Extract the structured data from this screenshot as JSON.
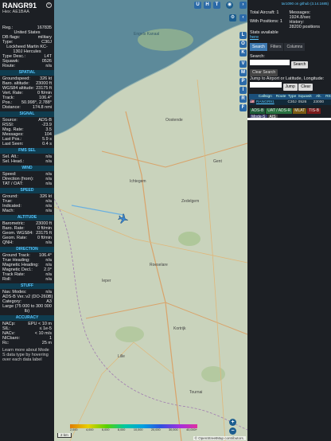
{
  "info": {
    "callsign": "RANGR91",
    "hex": "Hex: AE1BAA",
    "general": [
      {
        "k": "Reg.:",
        "v": "167835"
      },
      {
        "k": "",
        "v": "United States"
      },
      {
        "k": "DB flags:",
        "v": "military"
      },
      {
        "k": "Type:",
        "v": "C30J"
      },
      {
        "k": "",
        "v": "Lockheed Martin KC-130J Hercules"
      },
      {
        "k": "Type Desc.:",
        "v": "L4T"
      },
      {
        "k": "Squawk:",
        "v": "0526"
      },
      {
        "k": "Route:",
        "v": "n/a"
      }
    ],
    "sections": [
      {
        "title": "SPATIAL",
        "rows": [
          {
            "k": "Groundspeed:",
            "v": "326 kt"
          },
          {
            "k": "Baro. altitude:",
            "v": "23000 ft"
          },
          {
            "k": "WGS84 altitude:",
            "v": "23175 ft"
          },
          {
            "k": "Vert. Rate:",
            "v": "0 ft/min"
          },
          {
            "k": "Track:",
            "v": "106.4°"
          },
          {
            "k": "Pos.:",
            "v": "50.998°, 2.788°"
          },
          {
            "k": "Distance:",
            "v": "174.8 nmi"
          }
        ]
      },
      {
        "title": "SIGNAL",
        "rows": [
          {
            "k": "Source:",
            "v": "ADS-B"
          },
          {
            "k": "RSSI:",
            "v": "-23.9"
          },
          {
            "k": "Msg. Rate:",
            "v": "3.5"
          },
          {
            "k": "Messages:",
            "v": "104"
          },
          {
            "k": "Last Pos.:",
            "v": "5.9 s"
          },
          {
            "k": "Last Seen:",
            "v": "0.4 s"
          }
        ]
      },
      {
        "title": "FMS SEL",
        "rows": [
          {
            "k": "Sel. Alt.:",
            "v": "n/a"
          },
          {
            "k": "Sel. Head.:",
            "v": "n/a"
          }
        ]
      },
      {
        "title": "WIND",
        "rows": [
          {
            "k": "Speed:",
            "v": "n/a"
          },
          {
            "k": "Direction (from):",
            "v": "n/a"
          },
          {
            "k": "TAT / OAT:",
            "v": "n/a"
          }
        ]
      },
      {
        "title": "SPEED",
        "rows": [
          {
            "k": "Ground:",
            "v": "326 kt"
          },
          {
            "k": "True:",
            "v": "n/a"
          },
          {
            "k": "Indicated:",
            "v": "n/a"
          },
          {
            "k": "Mach:",
            "v": "n/a"
          }
        ]
      },
      {
        "title": "ALTITUDE",
        "rows": [
          {
            "k": "Barometric:",
            "v": "23000 ft"
          },
          {
            "k": "Baro. Rate:",
            "v": "0 ft/min"
          },
          {
            "k": "Geom. WGS84:",
            "v": "23175 ft"
          },
          {
            "k": "Geom. Rate:",
            "v": "0 ft/min"
          },
          {
            "k": "QNH:",
            "v": "n/a"
          }
        ]
      },
      {
        "title": "DIRECTION",
        "rows": [
          {
            "k": "Ground Track:",
            "v": "106.4°"
          },
          {
            "k": "True Heading:",
            "v": "n/a"
          },
          {
            "k": "Magnetic Heading:",
            "v": "n/a"
          },
          {
            "k": "Magnetic Decl.:",
            "v": "2.0°"
          },
          {
            "k": "Track Rate:",
            "v": "n/a"
          },
          {
            "k": "Roll:",
            "v": "n/a"
          }
        ]
      },
      {
        "title": "STUFF",
        "rows": [
          {
            "k": "Nav. Modes:",
            "v": "n/a"
          },
          {
            "k": "ADS-B Ver.:",
            "v": "v2 (DO-260B)"
          },
          {
            "k": "Category:",
            "v": "A3"
          },
          {
            "k": "Large (75 000 to 300 000 lb)",
            "v": ""
          }
        ]
      },
      {
        "title": "ACCURACY",
        "rows": [
          {
            "k": "NACp:",
            "v": "EPU < 10 m"
          },
          {
            "k": "SIL:",
            "v": "≤ 1e-5"
          },
          {
            "k": "NACv:",
            "v": "< 10 m/s"
          },
          {
            "k": "NICbaro:",
            "v": "1"
          },
          {
            "k": "Rc:",
            "v": "25 m"
          }
        ]
      }
    ],
    "footer": "Learn more about Mode S data type by hovering over each data label"
  },
  "map": {
    "labels": [
      "Engels Kanaal",
      "Oostende",
      "Ichtegem",
      "Zedelgem",
      "Roeselare",
      "Ieper",
      "Lille",
      "Kortrijk",
      "Tournai",
      "Gent"
    ],
    "top_buttons": [
      "U",
      "H",
      "T"
    ],
    "side_buttons": [
      "L",
      "O",
      "K",
      "V",
      "M",
      "P",
      "I",
      "R",
      "F"
    ],
    "attribution": "© OpenStreetMap contributors.",
    "scale": "2 km",
    "zoom_in": "+",
    "zoom_out": "−",
    "alt_ticks": [
      "2,000",
      "4,000",
      "6,000",
      "8,000",
      "10,000",
      "20,000",
      "30,000",
      "40,000+"
    ]
  },
  "panel": {
    "top_link": "tar1090 on github (3.14.1685)",
    "total_label": "Total Aircraft:",
    "total_value": "1",
    "messages_label": "Messages:",
    "messages_value": "1924.8/sec",
    "with_pos_label": "With Positions:",
    "with_pos_value": "1",
    "history_label": "History:",
    "history_value": "28200 positions",
    "stats_label": "Stats available",
    "stats_link": "here",
    "tabs": [
      "Search",
      "Filters",
      "Columns"
    ],
    "search_label": "Search:",
    "search_btn": "Search",
    "clear_search": "Clear Search",
    "jump_label": "Jump to Airport or Latitude, Longitude:",
    "jump_btn": "Jump",
    "clear_btn": "Clear",
    "table_headers": [
      "",
      "Callsign",
      "Route",
      "Type",
      "Squawk",
      "Alt.",
      "RSSI",
      "Spd"
    ],
    "table_row": [
      "🇺🇸",
      "RANGR91",
      "",
      "C30J",
      "0526",
      "23000",
      ""
    ],
    "legend": [
      {
        "label": "ADS-B",
        "color": "#1f5c3a"
      },
      {
        "label": "UAT / ADS-R",
        "color": "#29713f"
      },
      {
        "label": "MLAT",
        "color": "#7a5b12"
      },
      {
        "label": "TIS-B",
        "color": "#7a1b1b"
      },
      {
        "label": "Mode-S",
        "color": "#3a3a6a"
      },
      {
        "label": "AIS",
        "color": "#444"
      }
    ]
  }
}
